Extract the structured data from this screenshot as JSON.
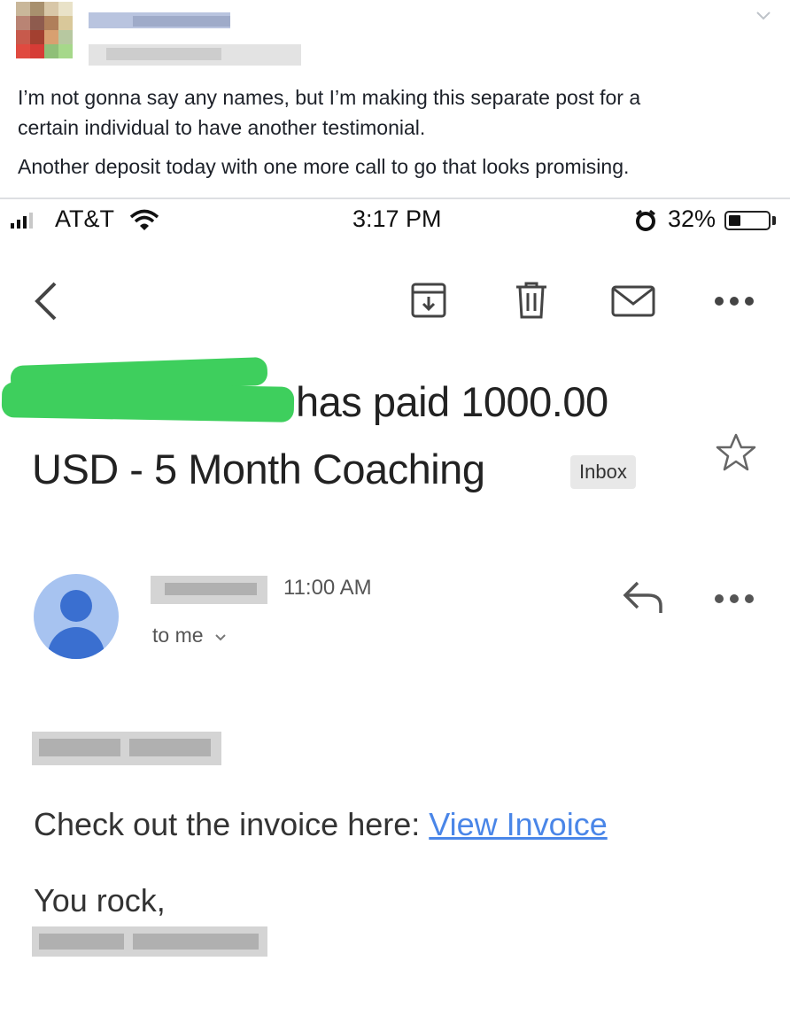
{
  "post": {
    "paragraph_1_line_1": "I’m not gonna say any names, but I’m making this separate post for a",
    "paragraph_1_line_2": "certain individual to have another testimonial.",
    "paragraph_2": "Another deposit today with one more call to go that looks promising."
  },
  "status_bar": {
    "carrier": "AT&T",
    "time": "3:17 PM",
    "battery": "32%",
    "battery_level": 0.32
  },
  "email": {
    "subject_line_1": "has paid 1000.00",
    "subject_line_2": "USD - 5 Month Coaching",
    "label": "Inbox",
    "received_time": "11:00 AM",
    "recipient": "to me",
    "body_line_1": "Check out the invoice here: ",
    "link_text": "View Invoice",
    "sign_off": "You rock,"
  },
  "icons": {
    "back": "back-chevron-icon",
    "archive": "archive-icon",
    "delete": "trash-icon",
    "mark_unread": "mail-icon",
    "more": "more-dots-icon",
    "star": "star-icon",
    "reply": "reply-icon",
    "wifi": "wifi-icon",
    "alarm": "alarm-icon"
  },
  "colors": {
    "link": "#4a86e8",
    "avatar_bg": "#a7c3f0",
    "avatar_fg": "#3a6fd0",
    "redaction": "#3ecf5d"
  }
}
